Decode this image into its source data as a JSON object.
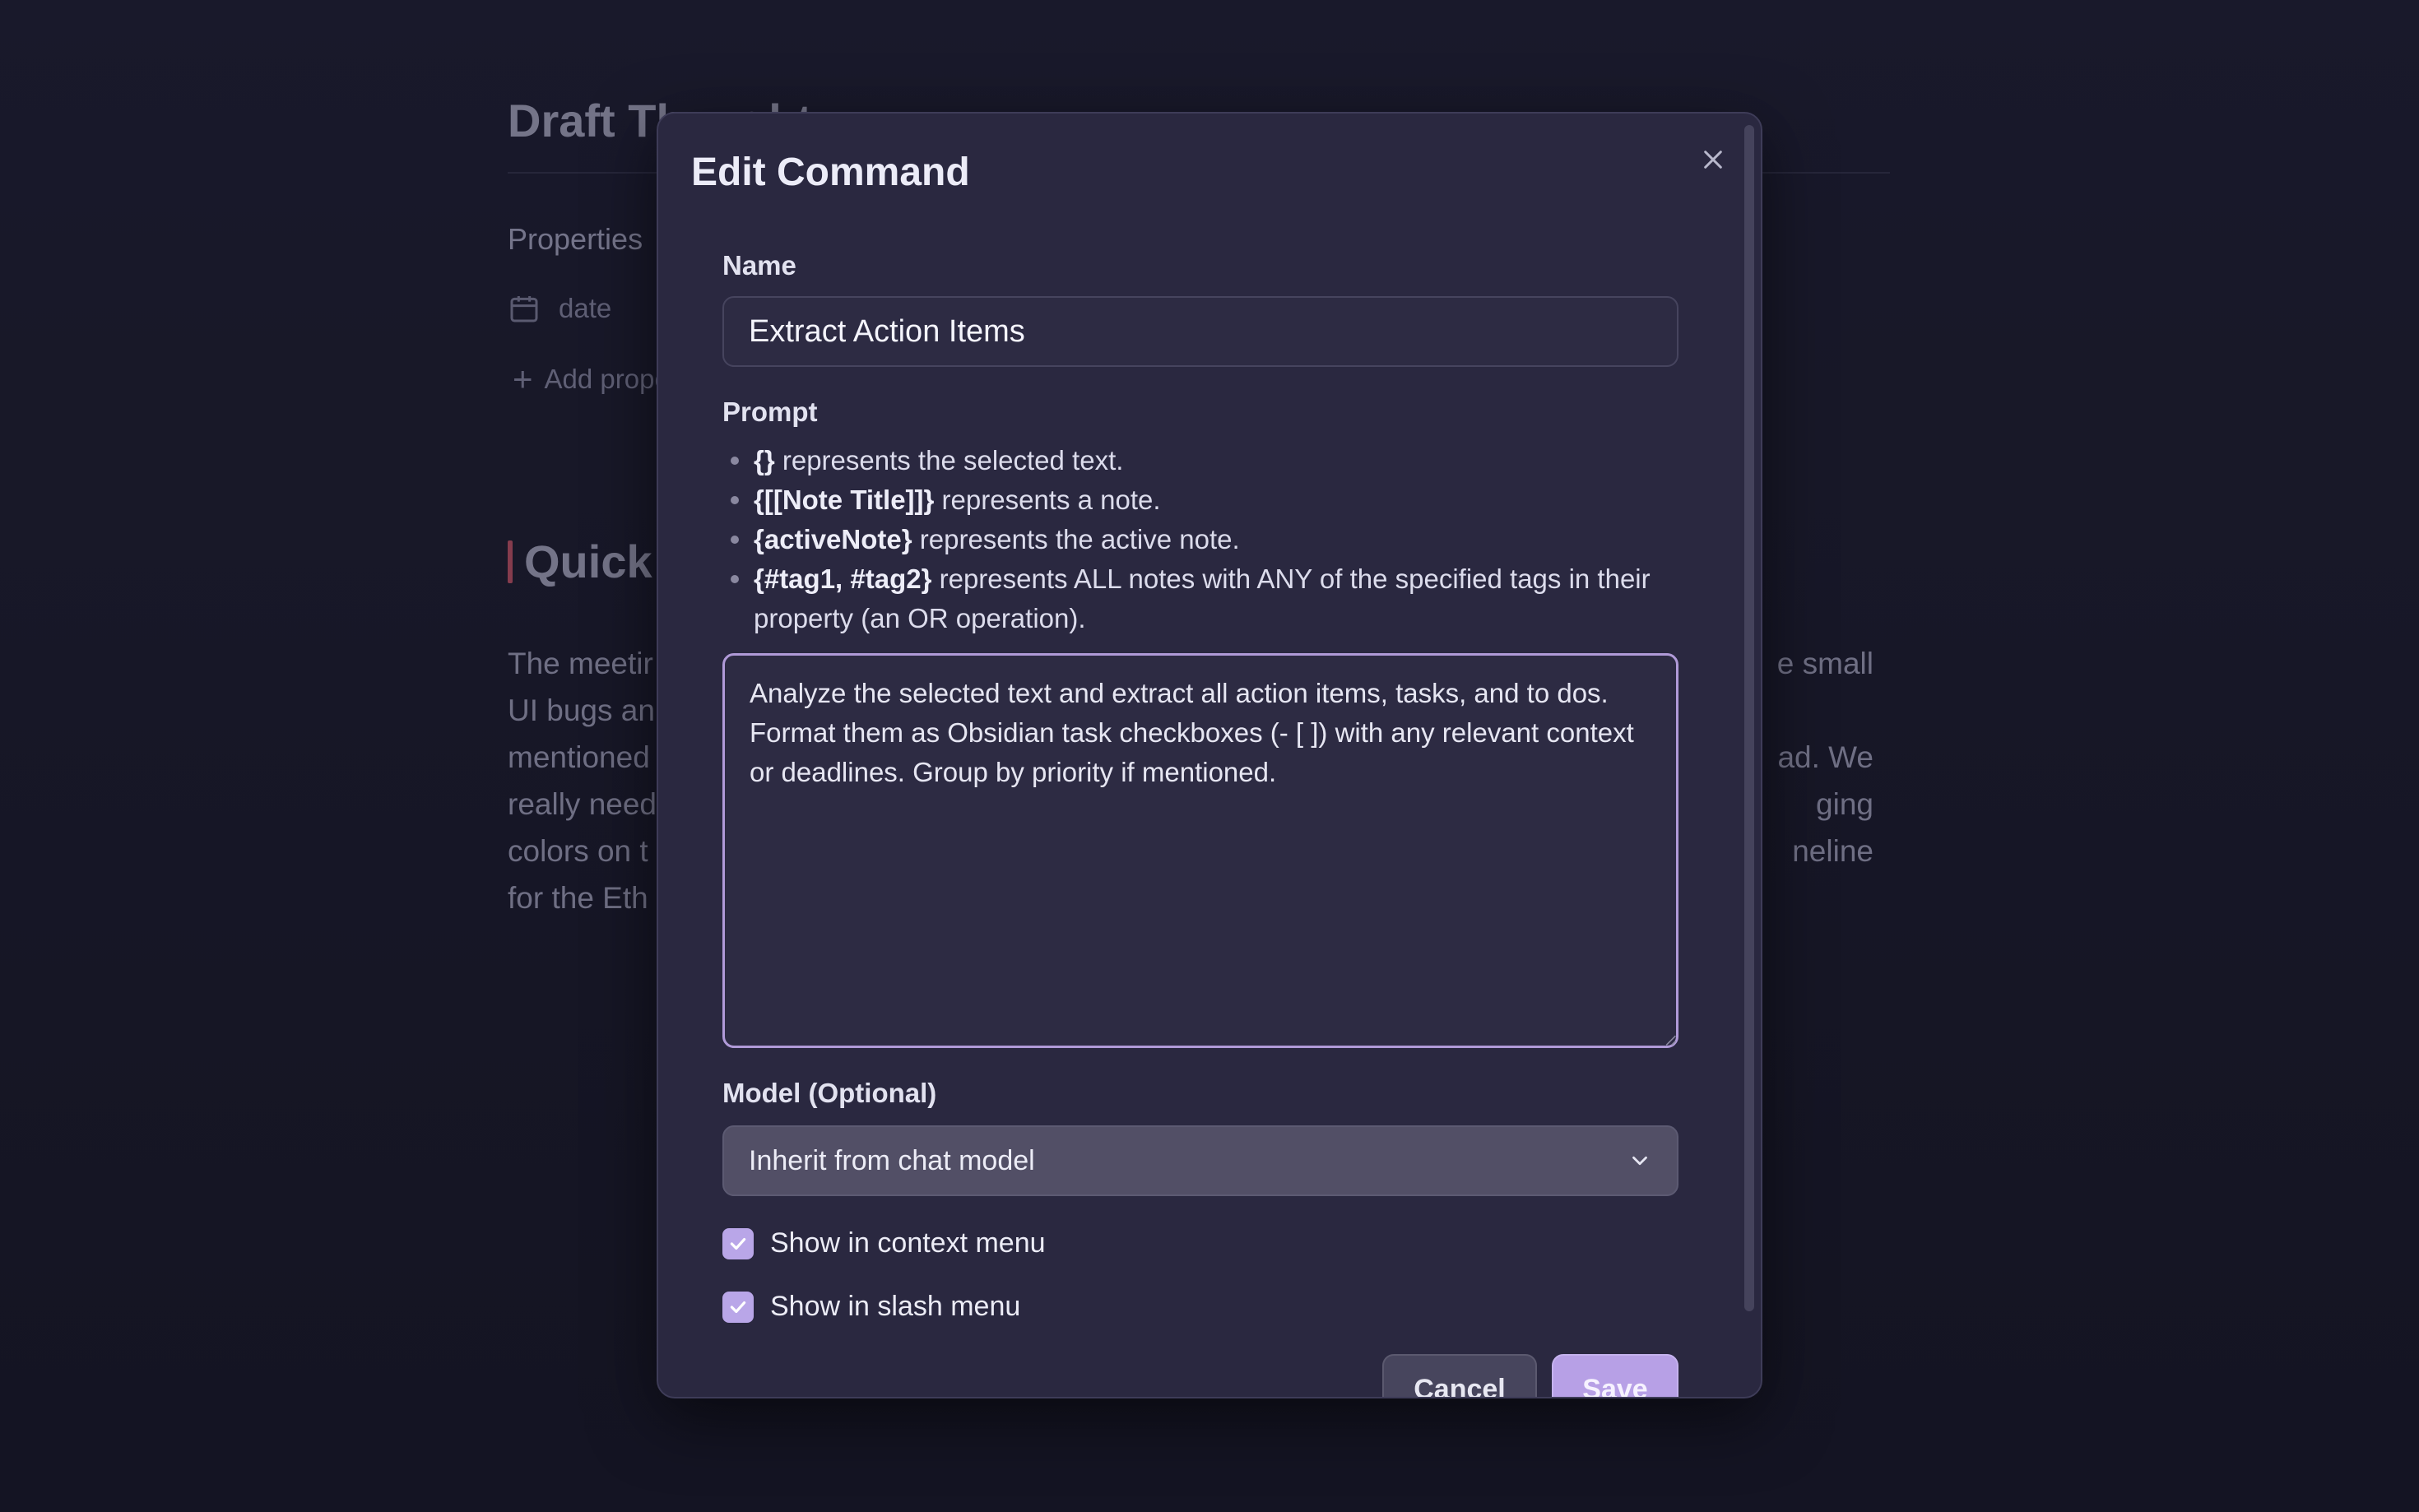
{
  "background_note": {
    "title": "Draft Thought",
    "properties_label": "Properties",
    "property_date": "date",
    "add_property": "Add property",
    "heading": "Quick",
    "paragraph_lines": [
      {
        "left": "The meetir",
        "right": "e small"
      },
      {
        "left": "UI bugs an",
        "right": ""
      },
      {
        "left": "mentioned",
        "right": "ad. We"
      },
      {
        "left": "really need",
        "right": "ging"
      },
      {
        "left": "colors on t",
        "right": "neline"
      },
      {
        "left": "for the Eth",
        "right": ""
      }
    ]
  },
  "modal": {
    "title": "Edit Command",
    "name_label": "Name",
    "name_value": "Extract Action Items",
    "prompt_label": "Prompt",
    "hints": [
      {
        "code": "{}",
        "text": " represents the selected text."
      },
      {
        "code": "{[[Note Title]]}",
        "text": " represents a note."
      },
      {
        "code": "{activeNote}",
        "text": " represents the active note."
      },
      {
        "code": "{#tag1, #tag2}",
        "text": " represents ALL notes with ANY of the specified tags in their property (an OR operation)."
      }
    ],
    "prompt_value": "Analyze the selected text and extract all action items, tasks, and to dos.\nFormat them as Obsidian task checkboxes (- [ ]) with any relevant context or deadlines. Group by priority if mentioned.",
    "model_label": "Model (Optional)",
    "model_value": "Inherit from chat model",
    "show_context_menu_label": "Show in context menu",
    "show_context_menu_checked": true,
    "show_slash_menu_label": "Show in slash menu",
    "show_slash_menu_checked": true,
    "cancel_label": "Cancel",
    "save_label": "Save"
  },
  "colors": {
    "accent": "#b7a0e6",
    "modal_bg": "#2a2840",
    "page_bg": "#1b1b2c"
  }
}
